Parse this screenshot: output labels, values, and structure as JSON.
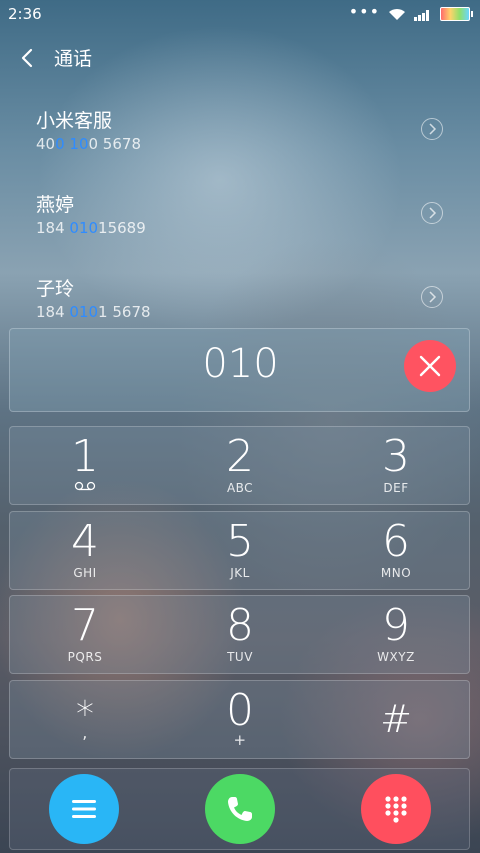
{
  "status_bar": {
    "time": "2:36"
  },
  "header": {
    "title": "通话"
  },
  "contacts": [
    {
      "name": "小米客服",
      "number_parts": [
        "40",
        "0 10",
        "0 5678"
      ]
    },
    {
      "name": "燕婷",
      "number_parts": [
        "184 ",
        "010",
        "15689"
      ]
    },
    {
      "name": "子玲",
      "number_parts": [
        "184 ",
        "010",
        "1 5678"
      ]
    }
  ],
  "dialer": {
    "input": "010"
  },
  "keypad": {
    "rows": [
      [
        {
          "digit": "1",
          "sub": ""
        },
        {
          "digit": "2",
          "sub": "ABC"
        },
        {
          "digit": "3",
          "sub": "DEF"
        }
      ],
      [
        {
          "digit": "4",
          "sub": "GHI"
        },
        {
          "digit": "5",
          "sub": "JKL"
        },
        {
          "digit": "6",
          "sub": "MNO"
        }
      ],
      [
        {
          "digit": "7",
          "sub": "PQRS"
        },
        {
          "digit": "8",
          "sub": "TUV"
        },
        {
          "digit": "9",
          "sub": "WXYZ"
        }
      ],
      [
        {
          "digit": "*",
          "sub": ","
        },
        {
          "digit": "0",
          "sub": "+"
        },
        {
          "digit": "#",
          "sub": ""
        }
      ]
    ]
  },
  "colors": {
    "highlight": "#2f8cff",
    "delete": "#ff5361",
    "menu": "#29b6f6",
    "call": "#4cd964",
    "keypad_toggle": "#ff4f5e"
  },
  "icons": {
    "back": "chevron-left-icon",
    "voicemail": "voicemail-icon",
    "menu": "menu-icon",
    "call": "phone-icon",
    "keypad_toggle": "dialpad-icon",
    "delete": "close-icon",
    "contact_detail": "chevron-right-icon"
  }
}
